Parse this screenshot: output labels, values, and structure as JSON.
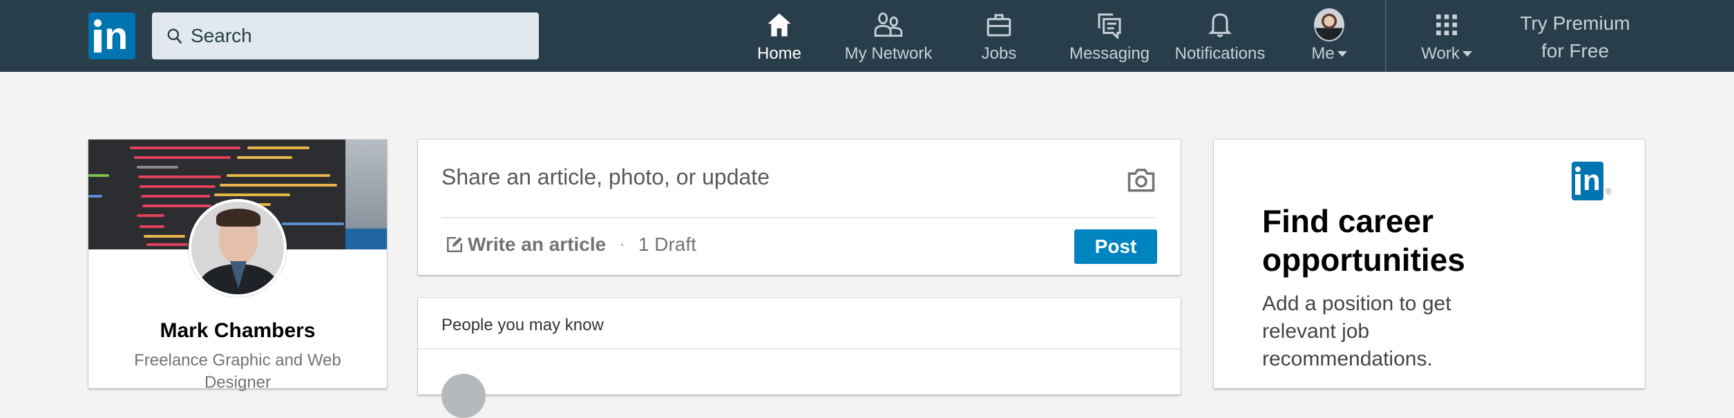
{
  "nav": {
    "logo_label": "in",
    "search_placeholder": "Search",
    "items": [
      {
        "label": "Home",
        "icon": "home-icon",
        "active": true
      },
      {
        "label": "My Network",
        "icon": "people-icon",
        "active": false
      },
      {
        "label": "Jobs",
        "icon": "briefcase-icon",
        "active": false
      },
      {
        "label": "Messaging",
        "icon": "chat-icon",
        "active": false
      },
      {
        "label": "Notifications",
        "icon": "bell-icon",
        "active": false
      },
      {
        "label": "Me",
        "icon": "avatar",
        "active": false,
        "dropdown": true
      },
      {
        "label": "Work",
        "icon": "grid-icon",
        "active": false,
        "dropdown": true
      }
    ],
    "premium_line1": "Try Premium",
    "premium_line2": "for Free"
  },
  "profile": {
    "name": "Mark Chambers",
    "headline": "Freelance Graphic and Web Designer"
  },
  "share": {
    "prompt": "Share an article, photo, or update",
    "write_article": "Write an article",
    "separator": "·",
    "drafts": "1 Draft",
    "post_label": "Post"
  },
  "people": {
    "heading": "People you may know"
  },
  "ad": {
    "logo_label": "in",
    "registered": "®",
    "heading": "Find career opportunities",
    "subtext": "Add a position to get relevant job recommendations."
  },
  "colors": {
    "nav_bg": "#283e4a",
    "brand_blue": "#0073b1",
    "post_button": "#0084bf",
    "page_bg": "#f3f3f3"
  }
}
